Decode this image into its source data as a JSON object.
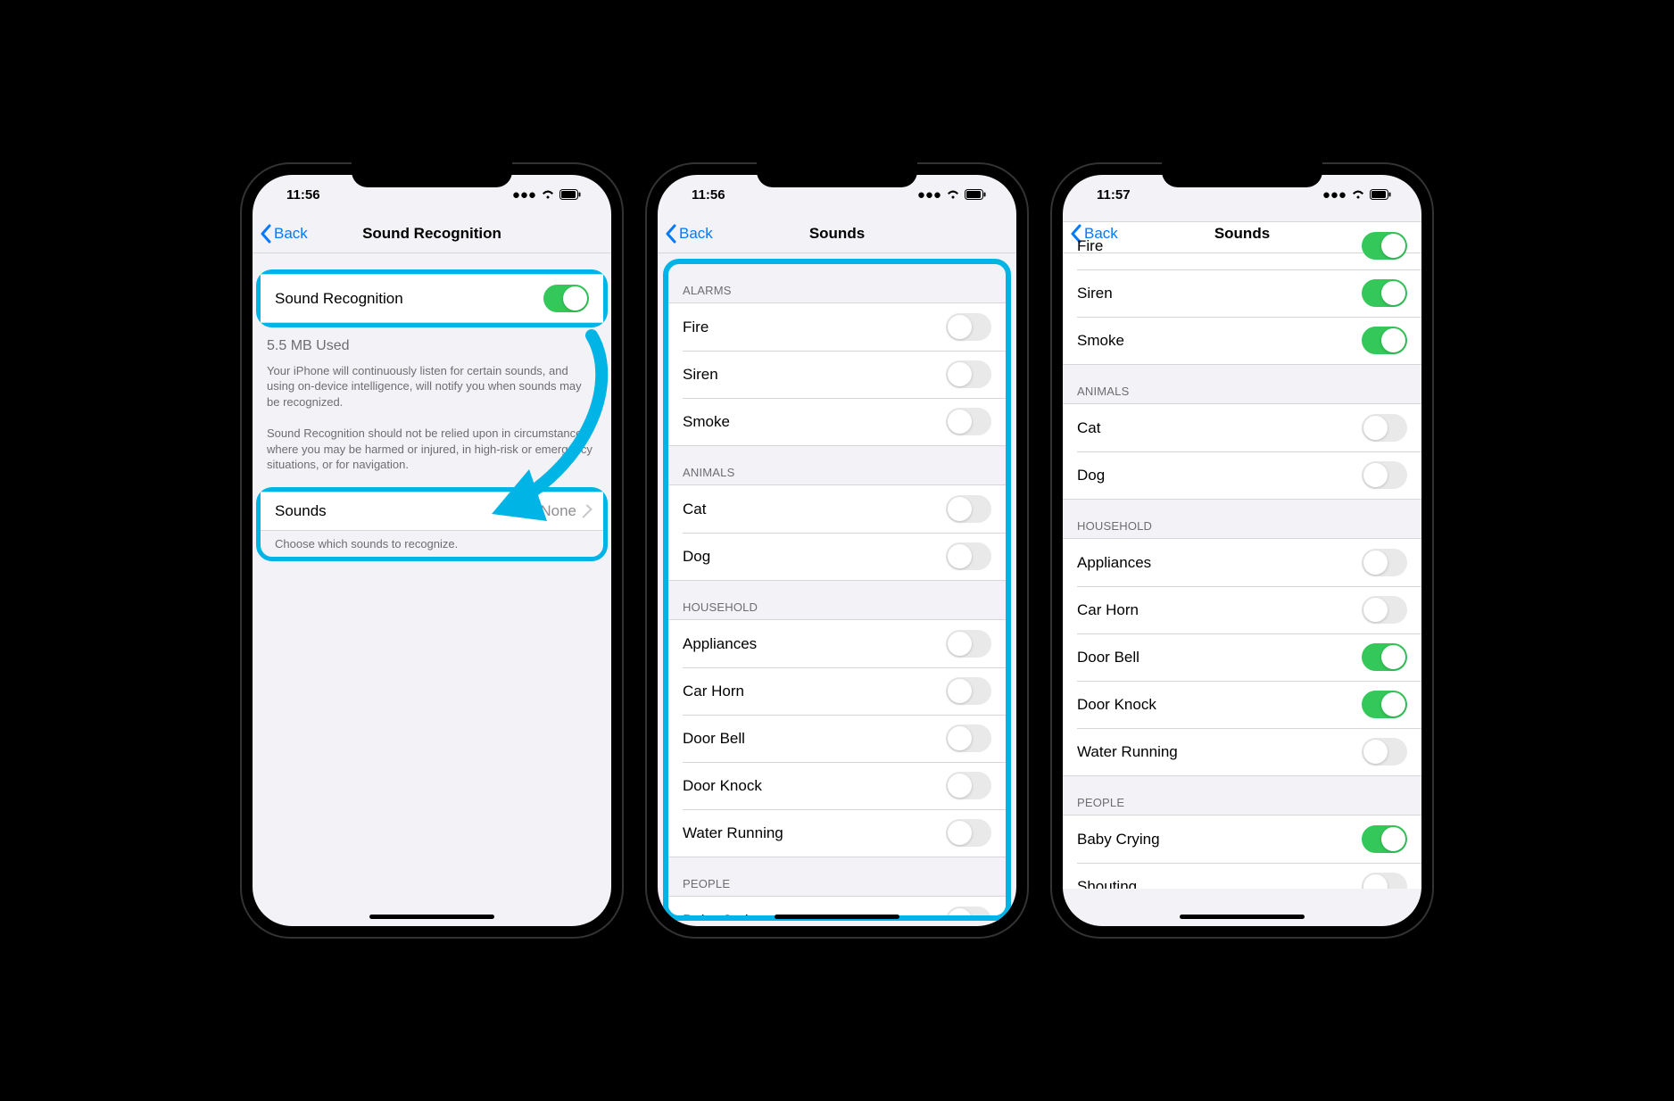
{
  "phone1": {
    "time": "11:56",
    "back": "Back",
    "title": "Sound Recognition",
    "main_toggle_label": "Sound Recognition",
    "main_toggle_on": true,
    "storage": "5.5 MB Used",
    "desc1": "Your iPhone will continuously listen for certain sounds, and using on-device intelligence, will notify you when sounds may be recognized.",
    "desc2": "Sound Recognition should not be relied upon in circumstances where you may be harmed or injured, in high-risk or emergency situations, or for navigation.",
    "sounds_label": "Sounds",
    "sounds_value": "None",
    "sounds_footer": "Choose which sounds to recognize."
  },
  "phone2": {
    "time": "11:56",
    "back": "Back",
    "title": "Sounds",
    "sections": {
      "alarms": {
        "header": "ALARMS",
        "items": [
          {
            "label": "Fire",
            "on": false
          },
          {
            "label": "Siren",
            "on": false
          },
          {
            "label": "Smoke",
            "on": false
          }
        ]
      },
      "animals": {
        "header": "ANIMALS",
        "items": [
          {
            "label": "Cat",
            "on": false
          },
          {
            "label": "Dog",
            "on": false
          }
        ]
      },
      "household": {
        "header": "HOUSEHOLD",
        "items": [
          {
            "label": "Appliances",
            "on": false
          },
          {
            "label": "Car Horn",
            "on": false
          },
          {
            "label": "Door Bell",
            "on": false
          },
          {
            "label": "Door Knock",
            "on": false
          },
          {
            "label": "Water Running",
            "on": false
          }
        ]
      },
      "people": {
        "header": "PEOPLE",
        "items": [
          {
            "label": "Baby Crying",
            "on": false
          }
        ]
      }
    }
  },
  "phone3": {
    "time": "11:57",
    "back": "Back",
    "title": "Sounds",
    "sections": {
      "alarms": {
        "items": [
          {
            "label": "Fire",
            "on": true
          },
          {
            "label": "Siren",
            "on": true
          },
          {
            "label": "Smoke",
            "on": true
          }
        ]
      },
      "animals": {
        "header": "ANIMALS",
        "items": [
          {
            "label": "Cat",
            "on": false
          },
          {
            "label": "Dog",
            "on": false
          }
        ]
      },
      "household": {
        "header": "HOUSEHOLD",
        "items": [
          {
            "label": "Appliances",
            "on": false
          },
          {
            "label": "Car Horn",
            "on": false
          },
          {
            "label": "Door Bell",
            "on": true
          },
          {
            "label": "Door Knock",
            "on": true
          },
          {
            "label": "Water Running",
            "on": false
          }
        ]
      },
      "people": {
        "header": "PEOPLE",
        "items": [
          {
            "label": "Baby Crying",
            "on": true
          },
          {
            "label": "Shouting",
            "on": false
          }
        ]
      }
    }
  }
}
